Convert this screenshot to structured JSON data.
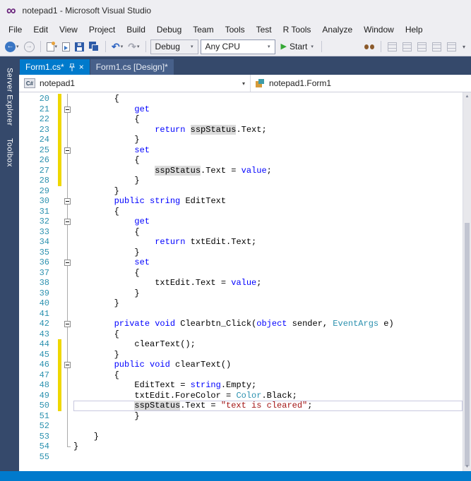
{
  "window": {
    "title": "notepad1 - Microsoft Visual Studio"
  },
  "menu": [
    "File",
    "Edit",
    "View",
    "Project",
    "Build",
    "Debug",
    "Team",
    "Tools",
    "Test",
    "R Tools",
    "Analyze",
    "Window",
    "Help"
  ],
  "toolbar": {
    "debug_target": "Debug",
    "platform": "Any CPU",
    "start": "Start"
  },
  "tabs": [
    {
      "label": "Form1.cs*",
      "active": true
    },
    {
      "label": "Form1.cs [Design]*",
      "active": false
    }
  ],
  "navbar": {
    "project_icon": "C#",
    "project": "notepad1",
    "type_name": "notepad1.Form1"
  },
  "side_tabs": [
    "Server Explorer",
    "Toolbox"
  ],
  "colors": {
    "accent": "#007ACC",
    "chrome": "#EEEEF2",
    "shell_dark": "#35496B",
    "keyword": "#0000FF",
    "type": "#2B91AF",
    "string": "#A31515",
    "line_number": "#2B91AF",
    "change_marker": "#EFD700",
    "symbol_highlight": "#DBDBDB"
  },
  "editor": {
    "current_line": 50,
    "highlighted_symbol": "sspStatus",
    "changed_lines": [
      [
        20,
        28
      ],
      [
        44,
        50
      ]
    ],
    "fold_boxes": [
      21,
      25,
      30,
      32,
      36,
      42,
      46
    ],
    "fold_vline_end": 53,
    "fold_corner": 54,
    "lines": [
      {
        "n": 20,
        "ind": 8,
        "t": [
          [
            "pl",
            "{"
          ]
        ]
      },
      {
        "n": 21,
        "ind": 12,
        "t": [
          [
            "kw",
            "get"
          ]
        ]
      },
      {
        "n": 22,
        "ind": 12,
        "t": [
          [
            "pl",
            "{"
          ]
        ]
      },
      {
        "n": 23,
        "ind": 16,
        "t": [
          [
            "kw",
            "return"
          ],
          [
            "pl",
            " "
          ],
          [
            "hl",
            "sspStatus"
          ],
          [
            "pl",
            ".Text;"
          ]
        ]
      },
      {
        "n": 24,
        "ind": 12,
        "t": [
          [
            "pl",
            "}"
          ]
        ]
      },
      {
        "n": 25,
        "ind": 12,
        "t": [
          [
            "kw",
            "set"
          ]
        ]
      },
      {
        "n": 26,
        "ind": 12,
        "t": [
          [
            "pl",
            "{"
          ]
        ]
      },
      {
        "n": 27,
        "ind": 16,
        "t": [
          [
            "hl",
            "sspStatus"
          ],
          [
            "pl",
            ".Text = "
          ],
          [
            "kw",
            "value"
          ],
          [
            "pl",
            ";"
          ]
        ]
      },
      {
        "n": 28,
        "ind": 12,
        "t": [
          [
            "pl",
            "}"
          ]
        ]
      },
      {
        "n": 29,
        "ind": 8,
        "t": [
          [
            "pl",
            "}"
          ]
        ]
      },
      {
        "n": 30,
        "ind": 8,
        "t": [
          [
            "kw",
            "public"
          ],
          [
            "pl",
            " "
          ],
          [
            "kw",
            "string"
          ],
          [
            "pl",
            " EditText"
          ]
        ]
      },
      {
        "n": 31,
        "ind": 8,
        "t": [
          [
            "pl",
            "{"
          ]
        ]
      },
      {
        "n": 32,
        "ind": 12,
        "t": [
          [
            "kw",
            "get"
          ]
        ]
      },
      {
        "n": 33,
        "ind": 12,
        "t": [
          [
            "pl",
            "{"
          ]
        ]
      },
      {
        "n": 34,
        "ind": 16,
        "t": [
          [
            "kw",
            "return"
          ],
          [
            "pl",
            " txtEdit.Text;"
          ]
        ]
      },
      {
        "n": 35,
        "ind": 12,
        "t": [
          [
            "pl",
            "}"
          ]
        ]
      },
      {
        "n": 36,
        "ind": 12,
        "t": [
          [
            "kw",
            "set"
          ]
        ]
      },
      {
        "n": 37,
        "ind": 12,
        "t": [
          [
            "pl",
            "{"
          ]
        ]
      },
      {
        "n": 38,
        "ind": 16,
        "t": [
          [
            "pl",
            "txtEdit.Text = "
          ],
          [
            "kw",
            "value"
          ],
          [
            "pl",
            ";"
          ]
        ]
      },
      {
        "n": 39,
        "ind": 12,
        "t": [
          [
            "pl",
            "}"
          ]
        ]
      },
      {
        "n": 40,
        "ind": 8,
        "t": [
          [
            "pl",
            "}"
          ]
        ]
      },
      {
        "n": 41,
        "ind": 0,
        "t": []
      },
      {
        "n": 42,
        "ind": 8,
        "t": [
          [
            "kw",
            "private"
          ],
          [
            "pl",
            " "
          ],
          [
            "kw",
            "void"
          ],
          [
            "pl",
            " Clearbtn_Click("
          ],
          [
            "kw",
            "object"
          ],
          [
            "pl",
            " sender, "
          ],
          [
            "ty",
            "EventArgs"
          ],
          [
            "pl",
            " e)"
          ]
        ]
      },
      {
        "n": 43,
        "ind": 8,
        "t": [
          [
            "pl",
            "{"
          ]
        ]
      },
      {
        "n": 44,
        "ind": 12,
        "t": [
          [
            "pl",
            "clearText();"
          ]
        ]
      },
      {
        "n": 45,
        "ind": 8,
        "t": [
          [
            "pl",
            "}"
          ]
        ]
      },
      {
        "n": 46,
        "ind": 8,
        "t": [
          [
            "kw",
            "public"
          ],
          [
            "pl",
            " "
          ],
          [
            "kw",
            "void"
          ],
          [
            "pl",
            " clearText()"
          ]
        ]
      },
      {
        "n": 47,
        "ind": 8,
        "t": [
          [
            "pl",
            "{"
          ]
        ]
      },
      {
        "n": 48,
        "ind": 12,
        "t": [
          [
            "pl",
            "EditText = "
          ],
          [
            "kw",
            "string"
          ],
          [
            "pl",
            ".Empty;"
          ]
        ]
      },
      {
        "n": 49,
        "ind": 12,
        "t": [
          [
            "pl",
            "txtEdit.ForeColor = "
          ],
          [
            "ty",
            "Color"
          ],
          [
            "pl",
            ".Black;"
          ]
        ]
      },
      {
        "n": 50,
        "ind": 12,
        "t": [
          [
            "hl",
            "sspStatus"
          ],
          [
            "pl",
            ".Text = "
          ],
          [
            "str",
            "\"text is cleared\""
          ],
          [
            "pl",
            ";"
          ]
        ]
      },
      {
        "n": 51,
        "ind": 12,
        "t": [
          [
            "pl",
            "}"
          ]
        ]
      },
      {
        "n": 52,
        "ind": 0,
        "t": []
      },
      {
        "n": 53,
        "ind": 4,
        "t": [
          [
            "pl",
            "}"
          ]
        ]
      },
      {
        "n": 54,
        "ind": 0,
        "t": [
          [
            "pl",
            "}"
          ]
        ]
      },
      {
        "n": 55,
        "ind": 0,
        "t": []
      }
    ]
  }
}
